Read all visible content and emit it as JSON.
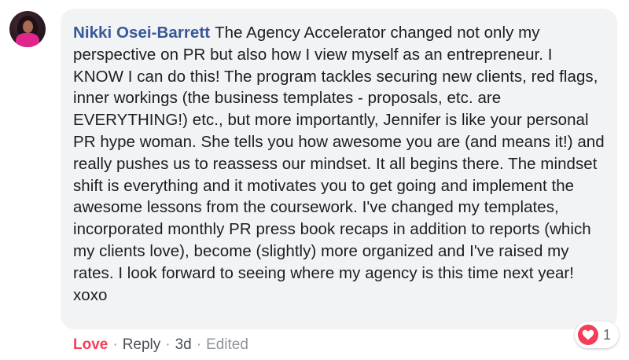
{
  "comment": {
    "author": "Nikki Osei-Barrett",
    "text": "The Agency Accelerator changed not only my perspective on PR but also how I view myself as an entrepreneur. I KNOW I can do this! The program tackles securing new clients, red flags, inner workings (the business templates - proposals, etc. are EVERYTHING!) etc., but more importantly, Jennifer is like your personal PR hype woman. She tells you how awesome you are (and means it!) and really pushes us to reassess our mindset. It all begins there. The mindset shift is everything and it motivates you to get going and implement the awesome lessons from the coursework. I've changed my templates, incorporated monthly PR press book recaps in addition to reports (which my clients love), become (slightly) more organized and I've raised my rates. I look forward to seeing where my agency is this time next year! xoxo"
  },
  "actions": {
    "love_label": "Love",
    "reply_label": "Reply",
    "timestamp": "3d",
    "edited_label": "Edited",
    "separator": "·"
  },
  "reaction": {
    "icon": "heart-icon",
    "count": "1",
    "color": "#f33e58"
  },
  "colors": {
    "author": "#385898",
    "bubble": "#f2f3f5",
    "love": "#f33e58",
    "meta": "#90949c"
  }
}
